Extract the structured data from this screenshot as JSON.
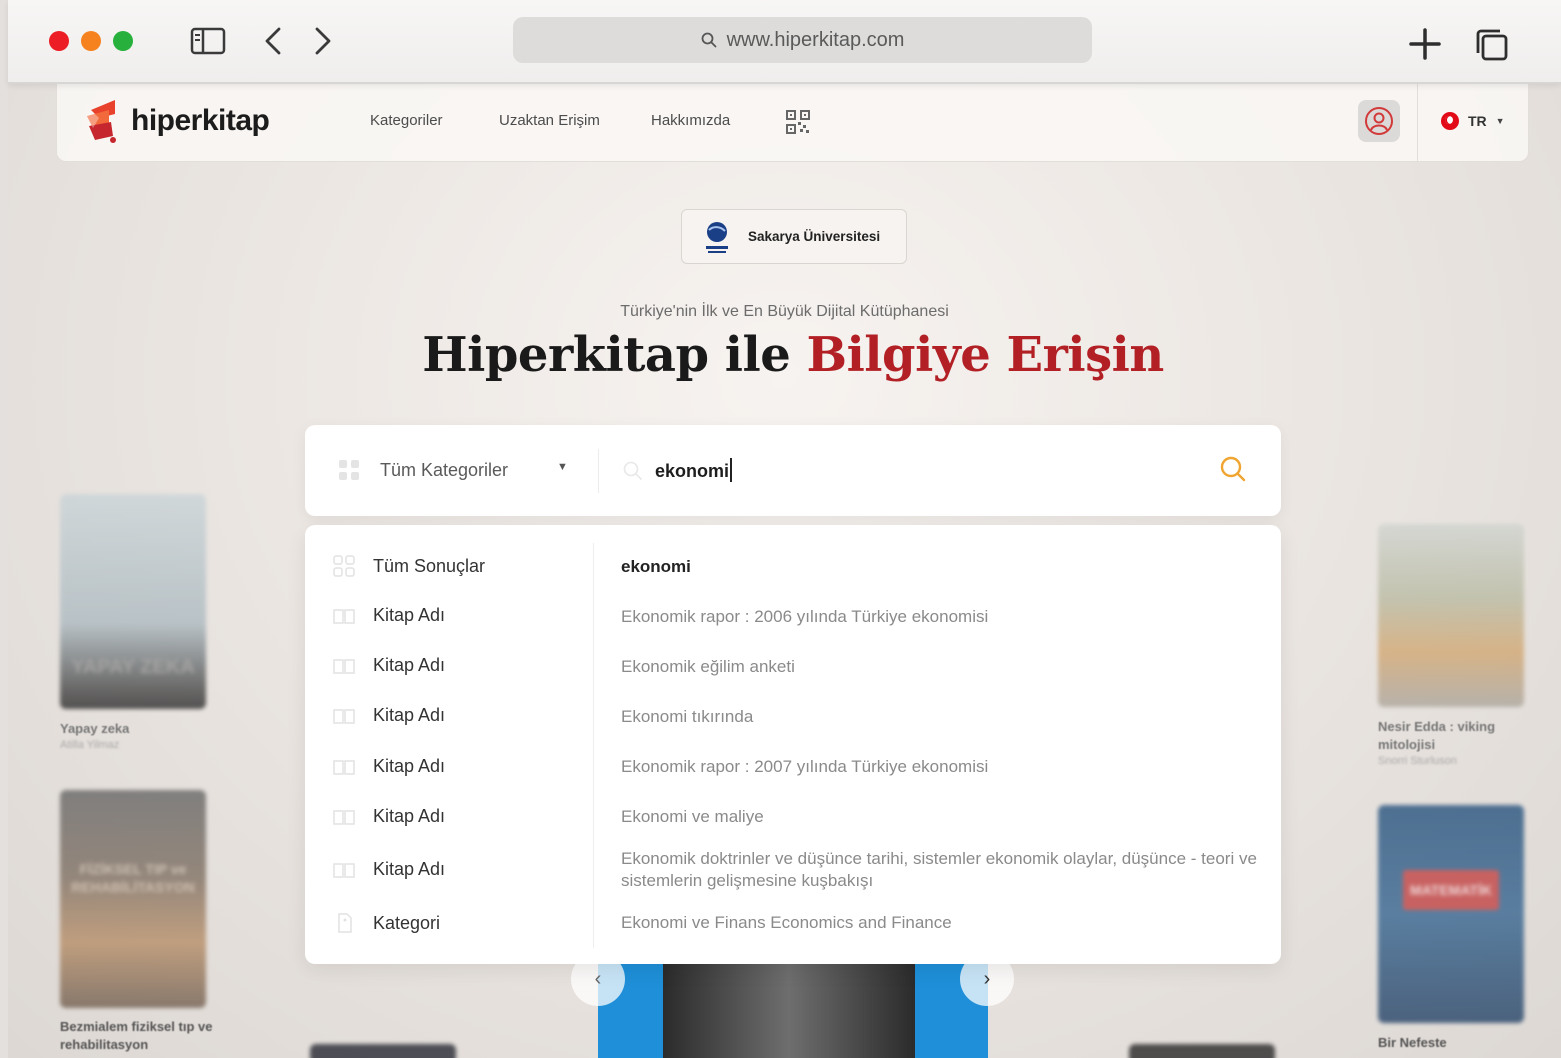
{
  "browser": {
    "url": "www.hiperkitap.com"
  },
  "nav": {
    "logo_text": "hiperkitap",
    "links": [
      "Kategoriler",
      "Uzaktan Erişim",
      "Hakkımızda"
    ],
    "language": "TR"
  },
  "institution": {
    "name": "Sakarya Üniversitesi"
  },
  "hero": {
    "tagline": "Türkiye'nin İlk ve En Büyük Dijital Kütüphanesi",
    "title_part1": "Hiperkitap ile",
    "title_part2": "Bilgiye Erişin"
  },
  "search": {
    "category": "Tüm Kategoriler",
    "query": "ekonomi"
  },
  "suggestions": [
    {
      "type": "Tüm Sonuçlar",
      "text": "ekonomi"
    },
    {
      "type": "Kitap Adı",
      "text": "Ekonomik rapor : 2006 yılında Türkiye ekonomisi"
    },
    {
      "type": "Kitap Adı",
      "text": "Ekonomik eğilim anketi"
    },
    {
      "type": "Kitap Adı",
      "text": "Ekonomi tıkırında"
    },
    {
      "type": "Kitap Adı",
      "text": "Ekonomik rapor : 2007 yılında Türkiye ekonomisi"
    },
    {
      "type": "Kitap Adı",
      "text": "Ekonomi ve maliye"
    },
    {
      "type": "Kitap Adı",
      "text": "Ekonomik doktrinler ve düşünce tarihi, sistemler ekonomik olaylar, düşünce - teori ve sistemlerin gelişmesine kuşbakışı"
    },
    {
      "type": "Kategori",
      "text": "Ekonomi ve Finans Economics and Finance"
    }
  ],
  "background_books": [
    {
      "title": "Yapay zeka",
      "author": "Atilla Yilmaz",
      "cover_text": "YAPAY ZEKA"
    },
    {
      "title": "Bezmialem fiziksel tıp ve rehabilitasyon",
      "cover_text": "FİZİKSEL TIP ve REHABİLİTASYON"
    },
    {
      "title": "Nesir Edda : viking mitolojisi",
      "author": "Snorri Sturluson"
    },
    {
      "title": "Bir Nefeste",
      "cover_text": "MATEMATİK"
    }
  ],
  "colors": {
    "brand_red": "#b21f24",
    "search_icon": "#f0a531",
    "chrome_bg": "#f3f2f1"
  }
}
